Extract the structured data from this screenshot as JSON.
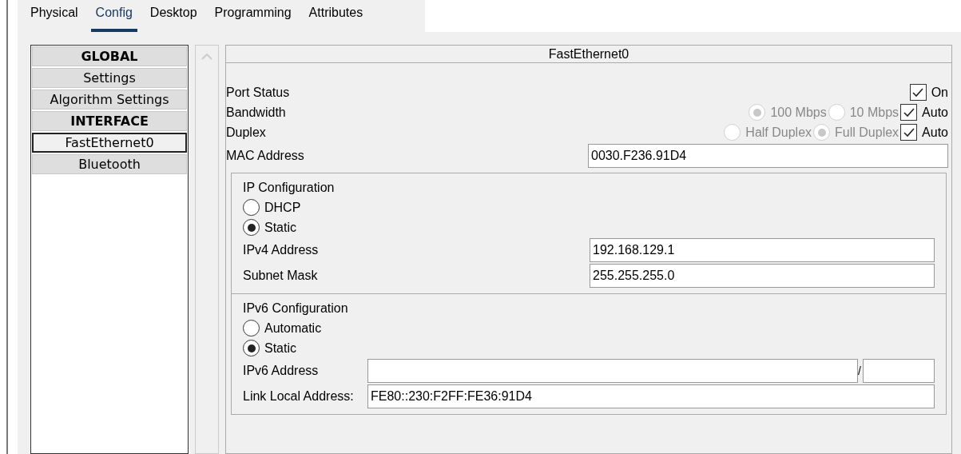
{
  "tabs": [
    {
      "label": "Physical",
      "selected": false
    },
    {
      "label": "Config",
      "selected": true
    },
    {
      "label": "Desktop",
      "selected": false
    },
    {
      "label": "Programming",
      "selected": false
    },
    {
      "label": "Attributes",
      "selected": false
    }
  ],
  "sidebar": {
    "items": [
      {
        "label": "GLOBAL",
        "kind": "header",
        "selected": false
      },
      {
        "label": "Settings",
        "kind": "item",
        "selected": false
      },
      {
        "label": "Algorithm Settings",
        "kind": "item",
        "selected": false
      },
      {
        "label": "INTERFACE",
        "kind": "header",
        "selected": false
      },
      {
        "label": "FastEthernet0",
        "kind": "item",
        "selected": true
      },
      {
        "label": "Bluetooth",
        "kind": "item",
        "selected": false
      }
    ]
  },
  "panel": {
    "title": "FastEthernet0",
    "port_status": {
      "label": "Port Status",
      "checkbox": {
        "label": "On",
        "checked": true
      }
    },
    "bandwidth": {
      "label": "Bandwidth",
      "options": [
        {
          "label": "100 Mbps",
          "selected": true,
          "disabled": true
        },
        {
          "label": "10 Mbps",
          "selected": false,
          "disabled": true
        }
      ],
      "auto": {
        "label": "Auto",
        "checked": true
      }
    },
    "duplex": {
      "label": "Duplex",
      "options": [
        {
          "label": "Half Duplex",
          "selected": false,
          "disabled": true
        },
        {
          "label": "Full Duplex",
          "selected": true,
          "disabled": true
        }
      ],
      "auto": {
        "label": "Auto",
        "checked": true
      }
    },
    "mac": {
      "label": "MAC Address",
      "value": "0030.F236.91D4"
    },
    "ip_config": {
      "title": "IP Configuration",
      "options": [
        {
          "label": "DHCP",
          "selected": false
        },
        {
          "label": "Static",
          "selected": true
        }
      ],
      "fields": [
        {
          "label": "IPv4 Address",
          "value": "192.168.129.1"
        },
        {
          "label": "Subnet Mask",
          "value": "255.255.255.0"
        }
      ]
    },
    "ipv6_config": {
      "title": "IPv6 Configuration",
      "options": [
        {
          "label": "Automatic",
          "selected": false
        },
        {
          "label": "Static",
          "selected": true
        }
      ],
      "address": {
        "label": "IPv6 Address",
        "separator": "/"
      },
      "link_local": {
        "label": "Link Local Address:",
        "value": "FE80::230:F2FF:FE36:91D4"
      }
    }
  }
}
